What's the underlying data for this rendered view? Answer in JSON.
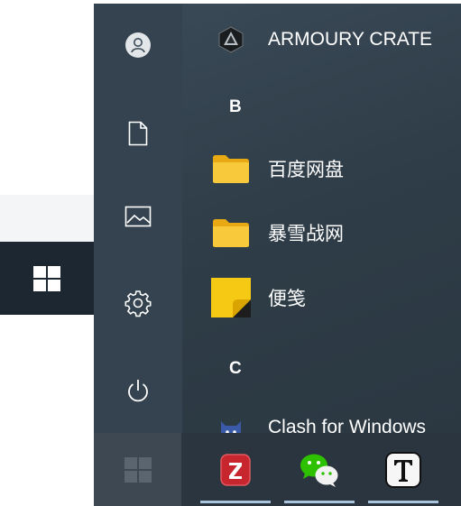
{
  "taskbar_fragment": {
    "start_icon": "windows-logo"
  },
  "start_menu": {
    "rail": [
      {
        "name": "user-account",
        "icon": "user-icon"
      },
      {
        "name": "documents",
        "icon": "document-icon"
      },
      {
        "name": "pictures",
        "icon": "picture-icon"
      },
      {
        "name": "settings",
        "icon": "gear-icon"
      },
      {
        "name": "power",
        "icon": "power-icon"
      }
    ],
    "apps": [
      {
        "label": "ARMOURY CRATE",
        "icon": "armoury-crate-icon"
      },
      {
        "label": "百度网盘",
        "icon": "folder-icon"
      },
      {
        "label": "暴雪战网",
        "icon": "folder-icon"
      },
      {
        "label": "便笺",
        "icon": "sticky-notes-icon"
      },
      {
        "label": "Clash for Windows",
        "icon": "clash-cat-icon"
      }
    ],
    "letters": [
      "B",
      "C"
    ]
  },
  "taskbar": {
    "items": [
      {
        "name": "start",
        "icon": "windows-logo"
      },
      {
        "name": "zotero",
        "icon": "zotero-icon",
        "glyph": "Z"
      },
      {
        "name": "wechat",
        "icon": "wechat-icon"
      },
      {
        "name": "typora",
        "icon": "typora-icon",
        "glyph": "T"
      }
    ]
  },
  "colors": {
    "menu_bg": "#2f3d48",
    "taskbar_bg": "#2b3540",
    "folder_yellow": "#f4c430",
    "zotero_red": "#c8262e",
    "wechat_green": "#2dc100",
    "active_underline": "#a9c4dc"
  }
}
